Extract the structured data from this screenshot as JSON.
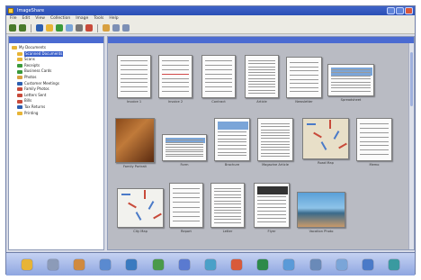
{
  "window": {
    "title": "ImageShare"
  },
  "menu": [
    "File",
    "Edit",
    "View",
    "Collection",
    "Image",
    "Tools",
    "Help"
  ],
  "toolbar_icons": [
    {
      "name": "back-icon",
      "color": "#4a7a2a"
    },
    {
      "name": "forward-icon",
      "color": "#4a7a2a"
    },
    {
      "name": "search-icon",
      "color": "#2d5fb0"
    },
    {
      "name": "folder-icon",
      "color": "#e7b436"
    },
    {
      "name": "refresh-icon",
      "color": "#3a9a3a"
    },
    {
      "name": "scan-icon",
      "color": "#7aa5d8"
    },
    {
      "name": "print-icon",
      "color": "#777777"
    },
    {
      "name": "delete-icon",
      "color": "#c84a3a"
    },
    {
      "name": "email-icon",
      "color": "#d8a040"
    },
    {
      "name": "view-icon",
      "color": "#7c8fb5"
    },
    {
      "name": "zoom-icon",
      "color": "#7c8fb5"
    }
  ],
  "tree": {
    "items": [
      {
        "label": "My Documents",
        "color": "#e7b436",
        "indent": false,
        "selected": false
      },
      {
        "label": "Scanned Documents",
        "color": "#e7b436",
        "indent": true,
        "selected": true
      },
      {
        "label": "Scans",
        "color": "#e7b436",
        "indent": true,
        "selected": false
      },
      {
        "label": "Receipts",
        "color": "#3a9a3a",
        "indent": true,
        "selected": false
      },
      {
        "label": "Business Cards",
        "color": "#3a9a3a",
        "indent": true,
        "selected": false
      },
      {
        "label": "Photos",
        "color": "#d8a040",
        "indent": true,
        "selected": false
      },
      {
        "label": "Customer Meetings",
        "color": "#2d5fb0",
        "indent": true,
        "selected": false
      },
      {
        "label": "Family Photos",
        "color": "#c84a3a",
        "indent": true,
        "selected": false
      },
      {
        "label": "Letters Sent",
        "color": "#c84a3a",
        "indent": true,
        "selected": false
      },
      {
        "label": "Bills",
        "color": "#c84a3a",
        "indent": true,
        "selected": false
      },
      {
        "label": "Tax Returns",
        "color": "#2d5fb0",
        "indent": true,
        "selected": false
      },
      {
        "label": "Printing",
        "color": "#e7b436",
        "indent": true,
        "selected": false
      }
    ]
  },
  "content": {
    "thumbnails": [
      {
        "label": "Invoice 1"
      },
      {
        "label": "Invoice 2"
      },
      {
        "label": "Contract"
      },
      {
        "label": "Article"
      },
      {
        "label": "Newsletter"
      },
      {
        "label": "Spreadsheet"
      },
      {
        "label": "Family Portrait"
      },
      {
        "label": "Form"
      },
      {
        "label": "Brochure"
      },
      {
        "label": "Magazine Article"
      },
      {
        "label": "Road Map"
      },
      {
        "label": "Memo"
      },
      {
        "label": "City Map"
      },
      {
        "label": "Report"
      },
      {
        "label": "Letter"
      },
      {
        "label": "Flyer"
      },
      {
        "label": "Vacation Photo"
      }
    ]
  },
  "bottom_icons": [
    {
      "name": "home-icon",
      "color": "#e7b436"
    },
    {
      "name": "scanner-icon",
      "color": "#8c9bb8"
    },
    {
      "name": "camera-icon",
      "color": "#d08a40"
    },
    {
      "name": "lock-icon",
      "color": "#5a8ad0"
    },
    {
      "name": "ocr-icon",
      "color": "#3a7ac0"
    },
    {
      "name": "convert-icon",
      "color": "#4a9a4a"
    },
    {
      "name": "web-icon",
      "color": "#5a7ad0"
    },
    {
      "name": "share-icon",
      "color": "#4aa0c8"
    },
    {
      "name": "pdf-icon",
      "color": "#d85a3a"
    },
    {
      "name": "email-icon",
      "color": "#2d8a4a"
    },
    {
      "name": "fax-icon",
      "color": "#5a9ad8"
    },
    {
      "name": "print-icon",
      "color": "#6a8ab8"
    },
    {
      "name": "export-icon",
      "color": "#7aa5d8"
    },
    {
      "name": "settings-icon",
      "color": "#4a7ac8"
    },
    {
      "name": "help-icon",
      "color": "#3a9aa0"
    }
  ]
}
